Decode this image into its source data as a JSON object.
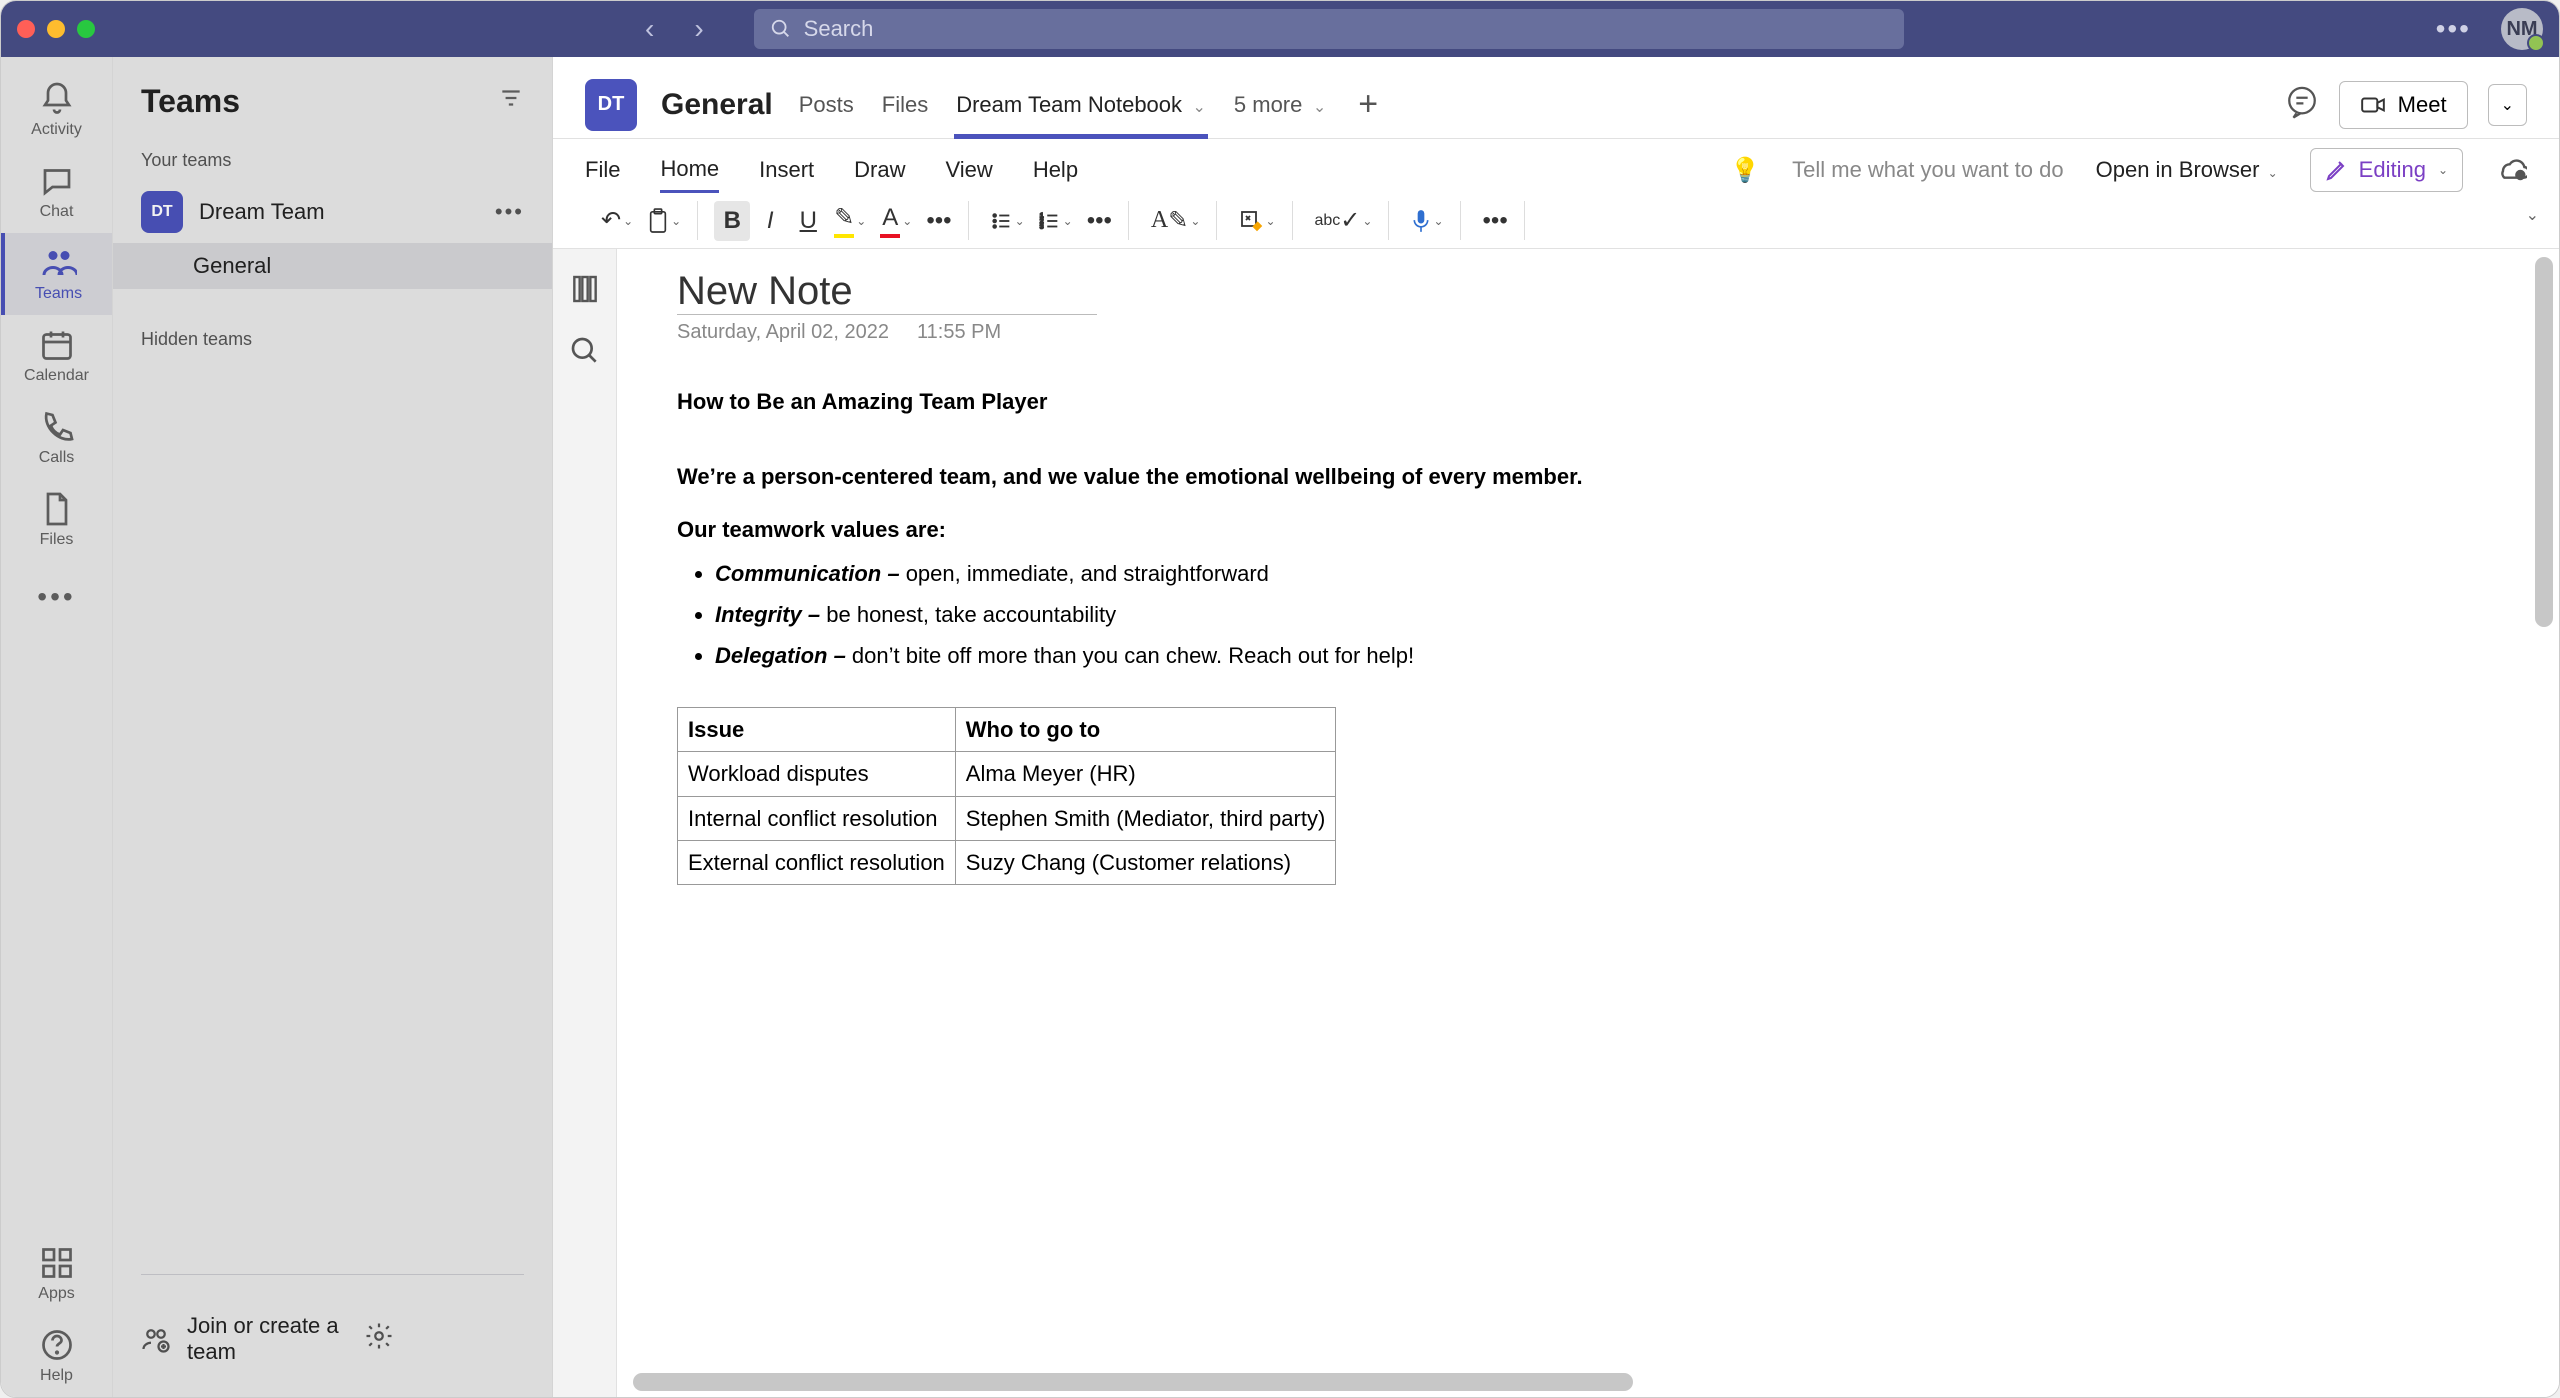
{
  "titlebar": {
    "search_placeholder": "Search",
    "avatar_initials": "NM"
  },
  "rail": {
    "items": [
      {
        "label": "Activity"
      },
      {
        "label": "Chat"
      },
      {
        "label": "Teams"
      },
      {
        "label": "Calendar"
      },
      {
        "label": "Calls"
      },
      {
        "label": "Files"
      }
    ],
    "apps_label": "Apps",
    "help_label": "Help"
  },
  "sidebar": {
    "title": "Teams",
    "your_teams_label": "Your teams",
    "team": {
      "initials": "DT",
      "name": "Dream Team"
    },
    "channel": "General",
    "hidden_label": "Hidden teams",
    "join_label": "Join or create a team"
  },
  "channel_header": {
    "avatar": "DT",
    "name": "General",
    "tabs": {
      "posts": "Posts",
      "files": "Files",
      "notebook": "Dream Team Notebook",
      "more": "5 more"
    },
    "meet_label": "Meet"
  },
  "ribbon": {
    "file": "File",
    "home": "Home",
    "insert": "Insert",
    "draw": "Draw",
    "view": "View",
    "help": "Help",
    "tellme": "Tell me what you want to do",
    "open_browser": "Open in Browser",
    "editing": "Editing"
  },
  "note": {
    "title": "New Note",
    "date": "Saturday, April 02, 2022",
    "time": "11:55 PM",
    "heading": "How to Be an Amazing Team Player",
    "intro": "We’re a person-centered team, and we value the emotional wellbeing of every member.",
    "values_label": "Our teamwork values are:",
    "bullets": [
      {
        "term": "Communication –",
        "text": " open, immediate, and straightforward"
      },
      {
        "term": "Integrity –",
        "text": " be honest, take accountability"
      },
      {
        "term": "Delegation –",
        "text": " don’t bite off more than you can chew. Reach out for help!"
      }
    ],
    "table": {
      "headers": [
        "Issue",
        "Who to go to"
      ],
      "rows": [
        [
          "Workload disputes",
          "Alma Meyer (HR)"
        ],
        [
          "Internal conflict resolution",
          "Stephen Smith (Mediator, third party)"
        ],
        [
          "External conflict resolution",
          "Suzy Chang (Customer relations)"
        ]
      ]
    }
  }
}
